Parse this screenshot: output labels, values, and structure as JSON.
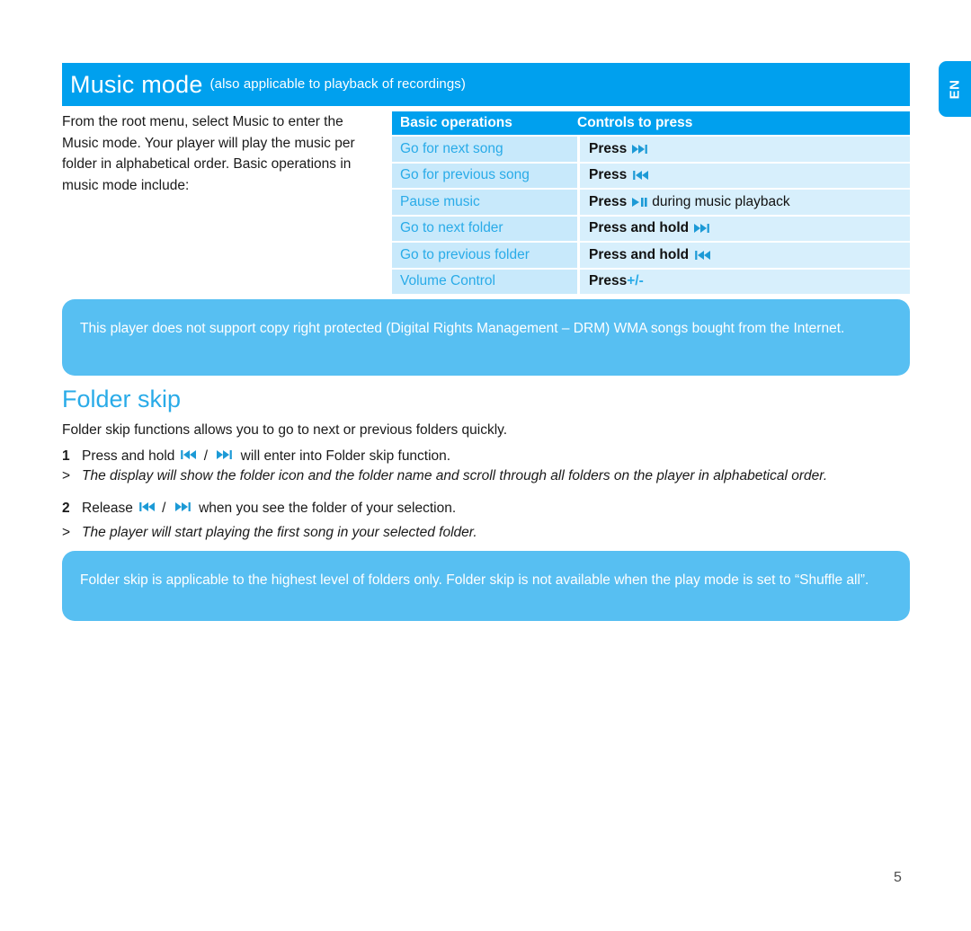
{
  "language_tab": {
    "label": "EN"
  },
  "header": {
    "title": "Music mode",
    "subtitle": "(also applicable to playback of recordings)",
    "bar_color": "#00A0EE"
  },
  "intro": {
    "paragraph": "From the root menu, select Music to enter the Music mode. Your player will play the music per folder in alphabetical order. Basic operations in music mode include:"
  },
  "ops_table": {
    "columns": [
      "Basic operations",
      "Controls to press"
    ],
    "rows": [
      {
        "operation": "Go for next song",
        "press_label": "Press",
        "icon": "next-track-icon",
        "suffix": ""
      },
      {
        "operation": "Go for previous song",
        "press_label": "Press",
        "icon": "prev-track-icon",
        "suffix": ""
      },
      {
        "operation": "Pause music",
        "press_label": "Press",
        "icon": "play-pause-icon",
        "suffix": "during music playback"
      },
      {
        "operation": "Go to next folder",
        "press_label": "Press and hold",
        "icon": "next-track-icon",
        "suffix": ""
      },
      {
        "operation": "Go to previous folder",
        "press_label": "Press and hold",
        "icon": "prev-track-icon",
        "suffix": ""
      },
      {
        "operation": "Volume Control",
        "press_label": "Press",
        "icon": "plus-minus-text",
        "suffix": "",
        "accent_text": "+/-"
      }
    ],
    "header_color": "#00A0EE",
    "left_cell_color": "#C8E9FB",
    "right_cell_color": "#D7EFFC",
    "left_text_color": "#29ABE8"
  },
  "note_drm": {
    "text": "This player does not support copy right protected (Digital Rights Management – DRM) WMA songs bought from the Internet.",
    "background": "#57BFF2"
  },
  "folder_skip": {
    "heading": "Folder skip",
    "intro": "Folder skip functions allows you to go to next or previous folders quickly.",
    "steps": [
      {
        "marker": "1",
        "prefix": "Press and hold",
        "icons": [
          "prev-track-icon",
          "next-track-icon"
        ],
        "suffix": "will enter into Folder skip function.",
        "italic": false
      },
      {
        "marker": ">",
        "prefix": "The display will show the folder icon and the folder name and scroll through all folders on the player in alphabetical order.",
        "icons": [],
        "suffix": "",
        "italic": true
      },
      {
        "marker": "2",
        "prefix": "Release",
        "icons": [
          "prev-track-icon",
          "next-track-icon"
        ],
        "suffix": "when you see the folder of your selection.",
        "italic": false
      },
      {
        "marker": ">",
        "prefix": "The player will start playing the first song in your selected folder.",
        "icons": [],
        "suffix": "",
        "italic": true
      }
    ]
  },
  "note_folder_skip": {
    "text": "Folder skip is applicable to the highest level of folders only. Folder skip is not available when the play mode is set to “Shuffle all”.",
    "background": "#57BFF2"
  },
  "footer": {
    "page_number": "5"
  }
}
